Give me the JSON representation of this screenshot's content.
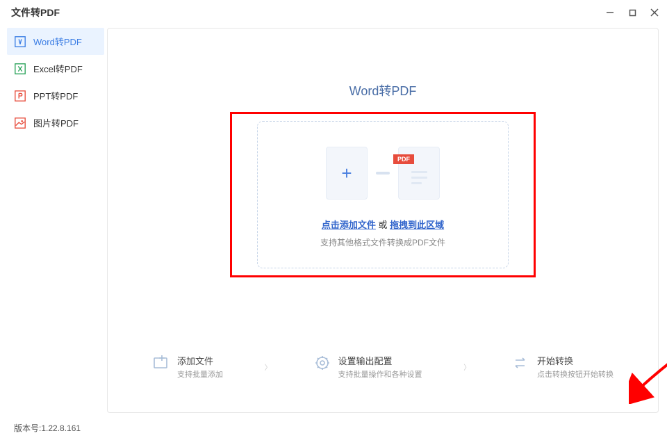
{
  "app": {
    "title": "文件转PDF",
    "version_label": "版本号:",
    "version": "1.22.8.161"
  },
  "sidebar": {
    "items": [
      {
        "label": "Word转PDF",
        "color": "#3b7de4",
        "active": true
      },
      {
        "label": "Excel转PDF",
        "color": "#2aa35a",
        "active": false
      },
      {
        "label": "PPT转PDF",
        "color": "#e74c3c",
        "active": false
      },
      {
        "label": "图片转PDF",
        "color": "#e74c3c",
        "active": false
      }
    ]
  },
  "main": {
    "title": "Word转PDF",
    "pdf_badge": "PDF",
    "drop": {
      "link1": "点击添加文件",
      "or": " 或 ",
      "link2": "拖拽到此区域",
      "sub": "支持其他格式文件转换成PDF文件"
    }
  },
  "steps": [
    {
      "title": "添加文件",
      "sub": "支持批量添加"
    },
    {
      "title": "设置输出配置",
      "sub": "支持批量操作和各种设置"
    },
    {
      "title": "开始转换",
      "sub": "点击转换按钮开始转换"
    }
  ]
}
